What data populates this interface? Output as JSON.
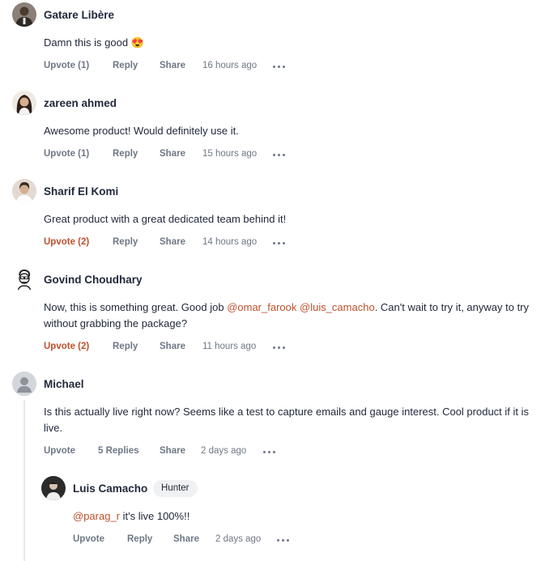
{
  "comments": [
    {
      "author": "Gatare Libère",
      "text": "Damn this is good",
      "emoji": "😍",
      "upvote": "Upvote (1)",
      "reply": "Reply",
      "share": "Share",
      "time": "16 hours ago",
      "upvoted": false,
      "avatar_color": "#6b6159"
    },
    {
      "author": "zareen ahmed",
      "text": "Awesome product! Would definitely use it.",
      "upvote": "Upvote (1)",
      "reply": "Reply",
      "share": "Share",
      "time": "15 hours ago",
      "upvoted": false,
      "avatar_color": "#3a2c24"
    },
    {
      "author": "Sharif El Komi",
      "text": "Great product with a great dedicated team behind it!",
      "upvote": "Upvote (2)",
      "reply": "Reply",
      "share": "Share",
      "time": "14 hours ago",
      "upvoted": true,
      "avatar_color": "#c9b8a8"
    },
    {
      "author": "Govind Choudhary",
      "text_before": "Now, this is something great. Good job ",
      "mention_1": "@omar_farook",
      "text_between": " ",
      "mention_2": "@luis_camacho",
      "text_after": ". Can't wait to try it, anyway to try without grabbing the package?",
      "upvote": "Upvote (2)",
      "reply": "Reply",
      "share": "Share",
      "time": "11 hours ago",
      "upvoted": true,
      "avatar_color": "#ffffff"
    },
    {
      "author": "Michael",
      "text": "Is this actually live right now? Seems like a test to capture emails and gauge interest. Cool product if it is live.",
      "upvote": "Upvote",
      "replies": "5 Replies",
      "share": "Share",
      "time": "2 days ago",
      "upvoted": false,
      "avatar_color": "#c4c8cf"
    }
  ],
  "reply": {
    "author": "Luis Camacho",
    "badge": "Hunter",
    "mention": "@parag_r",
    "text": " it's live 100%!!",
    "upvote": "Upvote",
    "reply": "Reply",
    "share": "Share",
    "time": "2 days ago",
    "avatar_color": "#2b2b2b"
  },
  "colors": {
    "accent": "#c0502b",
    "action_text": "#6f7786",
    "text": "#21293c"
  }
}
